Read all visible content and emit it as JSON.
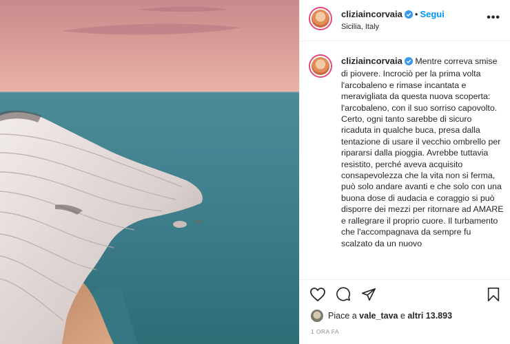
{
  "post": {
    "username": "cliziaincorvaia",
    "follow_label": "Segui",
    "separator": "•",
    "location": "Sicilia, Italy",
    "more_label": "•••"
  },
  "caption": {
    "username": "cliziaincorvaia",
    "paragraphs": [
      "Mentre correva smise di piovere. Incrociò per la prima volta l'arcobaleno e rimase incantata e meravigliata da questa nuova scoperta: l'arcobaleno, con il suo sorriso capovolto.",
      "Certo, ogni tanto sarebbe di sicuro ricaduta in qualche buca, presa dalla tentazione di usare il vecchio ombrello per ripararsi dalla pioggia. Avrebbe tuttavia resistito, perché aveva acquisito consapevolezza che la vita non si ferma, può solo andare avanti e che solo con una buona dose di audacia e coraggio si può disporre dei mezzi per ritornare ad AMARE e rallegrare il proprio cuore. Il turbamento che l'accompagnava da sempre fu scalzato da un nuovo"
    ]
  },
  "likes": {
    "prefix": "Piace a ",
    "user": "vale_tava",
    "middle": " e ",
    "others": "altri 13.893"
  },
  "timestamp": "1 ORA FA",
  "icons": {
    "like": "heart-icon",
    "comment": "comment-icon",
    "share": "share-icon",
    "save": "bookmark-icon",
    "verified": "verified-badge-icon"
  },
  "colors": {
    "follow": "#0095f6",
    "verified": "#3897f0",
    "secondary_text": "#8e8e8e",
    "border": "#efefef"
  }
}
